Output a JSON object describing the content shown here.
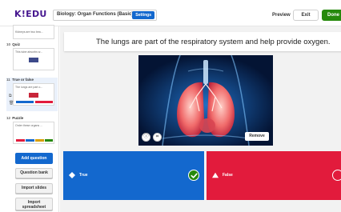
{
  "app": {
    "logo": "K!EDU",
    "quiz_title": "Biology: Organ Functions (Basic)",
    "settings_label": "Settings",
    "preview_label": "Preview",
    "exit_label": "Exit",
    "done_label": "Done"
  },
  "sidebar": {
    "slides": [
      {
        "number": "",
        "type": "",
        "preview_text": "Kidneys are two bea..."
      },
      {
        "number": "10",
        "type": "Quiz",
        "preview_text": "This tube absorbs w..."
      },
      {
        "number": "11",
        "type": "True or false",
        "preview_text": "The lungs are part o..."
      },
      {
        "number": "12",
        "type": "Puzzle",
        "preview_text": "Order these organs ..."
      }
    ],
    "add_question_label": "Add question",
    "question_bank_label": "Question bank",
    "import_slides_label": "Import slides",
    "import_spreadsheet_line1": "Import",
    "import_spreadsheet_line2": "spreadsheet"
  },
  "editor": {
    "question": "The lungs are part of the respiratory system and help provide oxygen.",
    "remove_label": "Remove",
    "answers": [
      {
        "label": "True",
        "color": "#1368ce",
        "shape": "diamond",
        "correct": true
      },
      {
        "label": "False",
        "color": "#e21b3c",
        "shape": "triangle",
        "correct": false
      }
    ]
  },
  "colors": {
    "brand": "#46178f",
    "primary_blue": "#1368ce",
    "done_green": "#26890c",
    "answer_red": "#e21b3c"
  }
}
